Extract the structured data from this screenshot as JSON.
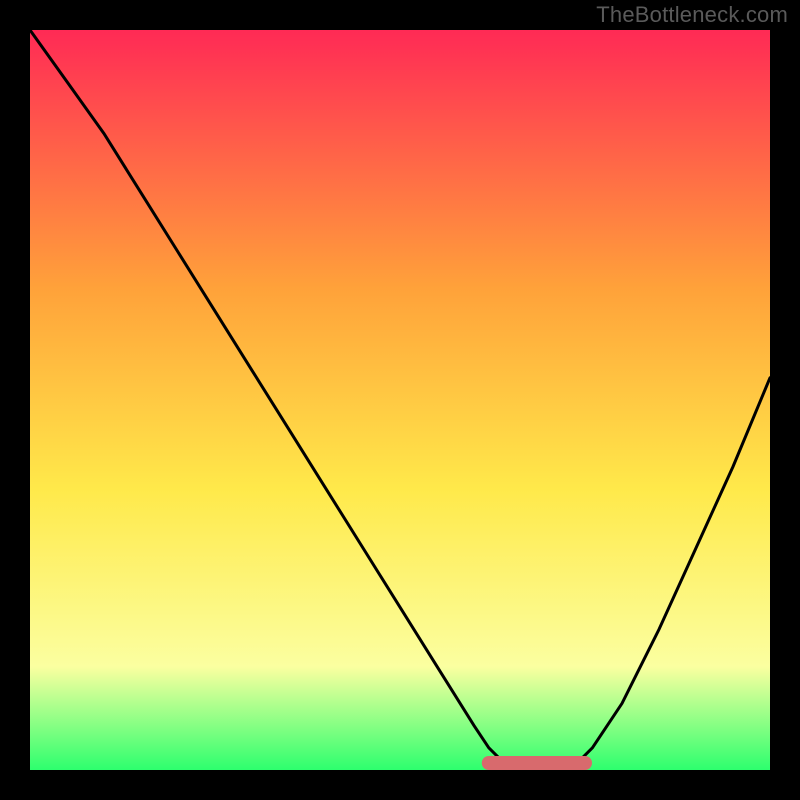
{
  "attribution": "TheBottleneck.com",
  "colors": {
    "bg": "#000000",
    "gradient_top": "#ff2a55",
    "gradient_mid1": "#ffa23a",
    "gradient_mid2": "#ffe94a",
    "gradient_mid3": "#fbffa0",
    "gradient_bottom": "#2dff6e",
    "curve": "#000000",
    "marker": "#d86a6d"
  },
  "chart_data": {
    "type": "line",
    "title": "",
    "xlabel": "",
    "ylabel": "",
    "xlim": [
      0,
      100
    ],
    "ylim": [
      0,
      100
    ],
    "grid": false,
    "legend": false,
    "series": [
      {
        "name": "bottleneck-curve",
        "x": [
          0,
          5,
          10,
          15,
          20,
          25,
          30,
          35,
          40,
          45,
          50,
          55,
          60,
          62,
          64,
          66,
          68,
          70,
          72,
          74,
          76,
          80,
          85,
          90,
          95,
          100
        ],
        "values": [
          100,
          93,
          86,
          78,
          70,
          62,
          54,
          46,
          38,
          30,
          22,
          14,
          6,
          3,
          1,
          0,
          0,
          0,
          0,
          1,
          3,
          9,
          19,
          30,
          41,
          53
        ]
      }
    ],
    "markers": [
      {
        "name": "optimal-range",
        "x_start": 62,
        "x_end": 75,
        "y": 0
      }
    ],
    "annotations": []
  }
}
